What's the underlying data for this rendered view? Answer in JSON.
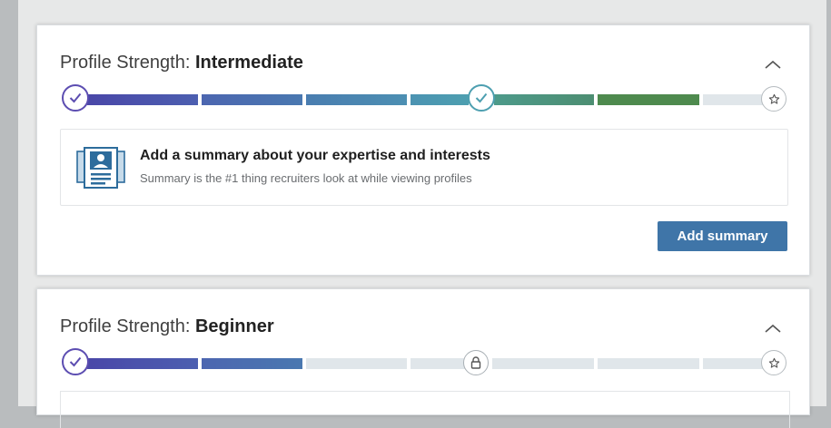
{
  "cards": [
    {
      "title_prefix": "Profile Strength: ",
      "level": "Intermediate",
      "progress_fraction": 0.86,
      "suggestion": {
        "heading": "Add a summary about your expertise and interests",
        "subtext": "Summary is the #1 thing recruiters look at while viewing profiles",
        "icon": "profile-summary-icon"
      },
      "action_label": "Add summary"
    },
    {
      "title_prefix": "Profile Strength: ",
      "level": "Beginner",
      "progress_fraction": 0.29
    }
  ],
  "icons": {
    "collapse": "chevron-up-icon",
    "start_node": "check-icon",
    "mid_node_card1": "check-icon",
    "mid_node_card2": "lock-icon",
    "end_node": "star-icon"
  },
  "colors": {
    "accent_button": "#3f75a8",
    "progress_start": "#5c4db1",
    "progress_mid": "#4d9fb0",
    "progress_end": "#4e8a4e",
    "track_empty": "#e0e6ea"
  }
}
